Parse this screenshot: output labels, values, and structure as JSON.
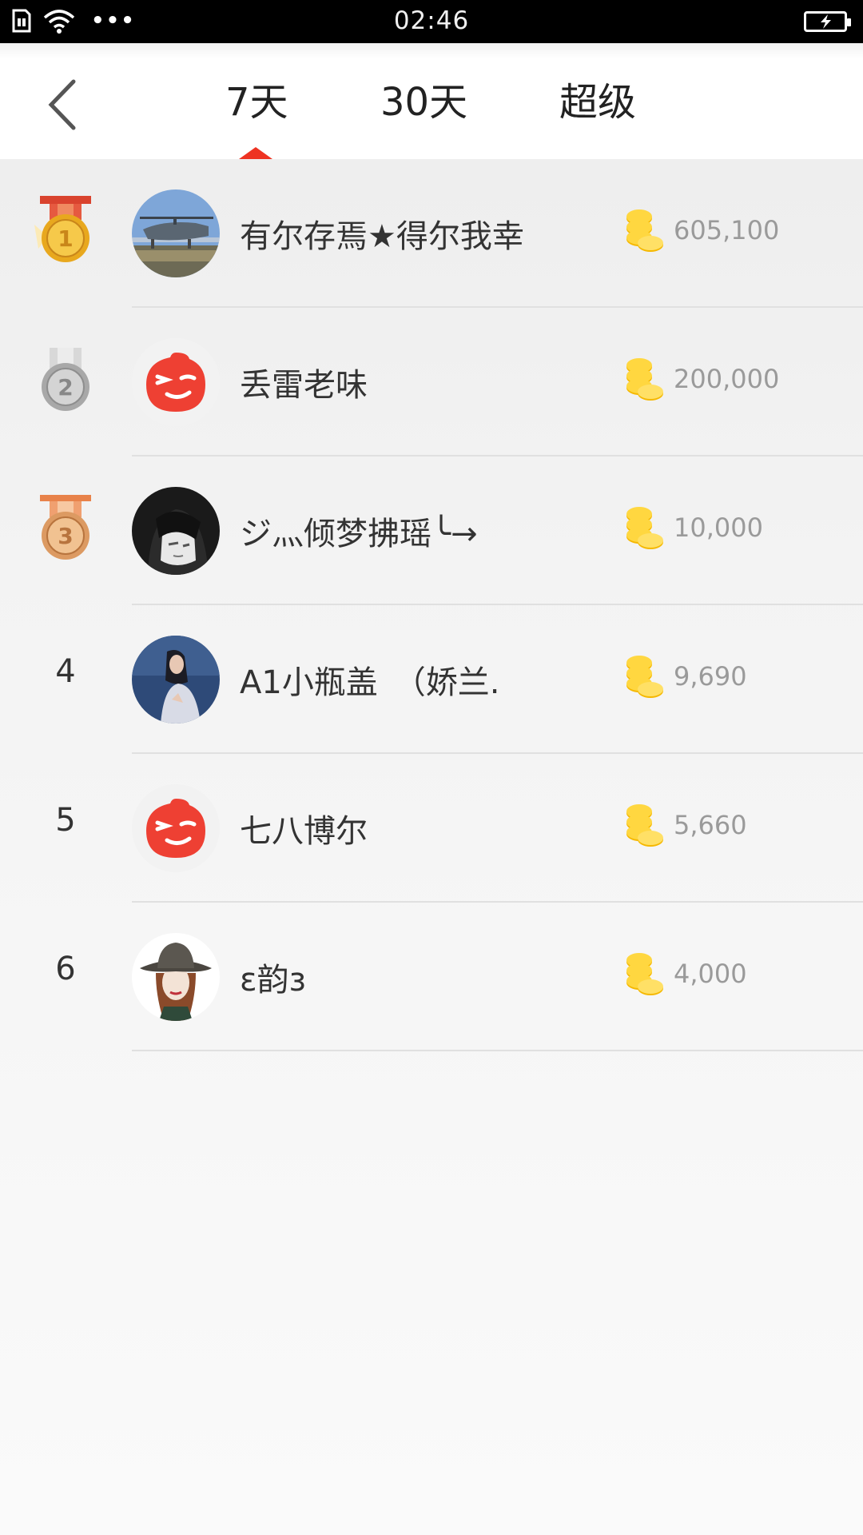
{
  "status_bar": {
    "time": "02:46"
  },
  "header": {
    "tabs": [
      {
        "label": "7天",
        "selected": true
      },
      {
        "label": "30天",
        "selected": false
      },
      {
        "label": "超级",
        "selected": false
      }
    ],
    "indicator_color": "#ee3322"
  },
  "ranking": [
    {
      "rank": "1",
      "medal": "gold",
      "name": "有尔存焉★得尔我幸",
      "amount": "605,100",
      "avatar": "helicopter-photo"
    },
    {
      "rank": "2",
      "medal": "silver",
      "name": "丢雷老味",
      "amount": "200,000",
      "avatar": "default-red-face"
    },
    {
      "rank": "3",
      "medal": "bronze",
      "name": "ジ灬倾梦拂瑶╰→",
      "amount": "10,000",
      "avatar": "anime-portrait"
    },
    {
      "rank": "4",
      "medal": null,
      "name": "A1小瓶盖　（娇兰.",
      "amount": "9,690",
      "avatar": "woman-photo"
    },
    {
      "rank": "5",
      "medal": null,
      "name": "七八博尔",
      "amount": "5,660",
      "avatar": "default-red-face"
    },
    {
      "rank": "6",
      "medal": null,
      "name": "ɛ韵ɜ",
      "amount": "4,000",
      "avatar": "hat-girl-illustration"
    }
  ],
  "colors": {
    "accent": "#ee3322",
    "gold_coin": "#f5b800",
    "amount_text": "#9a9a9a"
  }
}
